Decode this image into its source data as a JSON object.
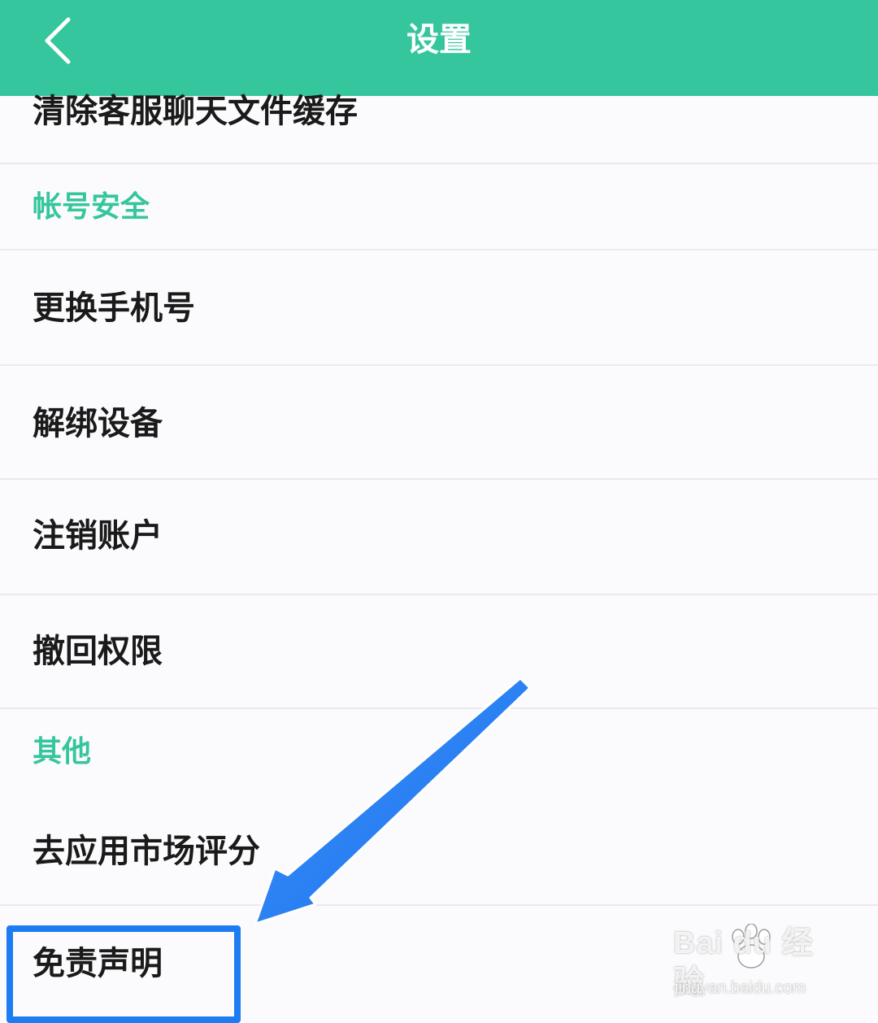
{
  "header": {
    "title": "设置",
    "back_icon": "chevron-left-icon",
    "background_color": "#35c69d"
  },
  "list": {
    "partial_item": "清除客服聊天文件缓存",
    "account_section": "帐号安全",
    "change_phone": "更换手机号",
    "unbind_device": "解绑设备",
    "cancel_account": "注销账户",
    "revoke_permissions": "撤回权限",
    "other_section": "其他",
    "rate_app": "去应用市场评分",
    "disclaimer": "免责声明"
  },
  "annotation": {
    "highlight_color": "#1e7cf2",
    "arrow_icon": "arrow-pointer-icon"
  },
  "watermark": {
    "brand": "Bai du 经验",
    "url": "jingyan.baidu.com",
    "logo_icon": "paw-icon"
  }
}
